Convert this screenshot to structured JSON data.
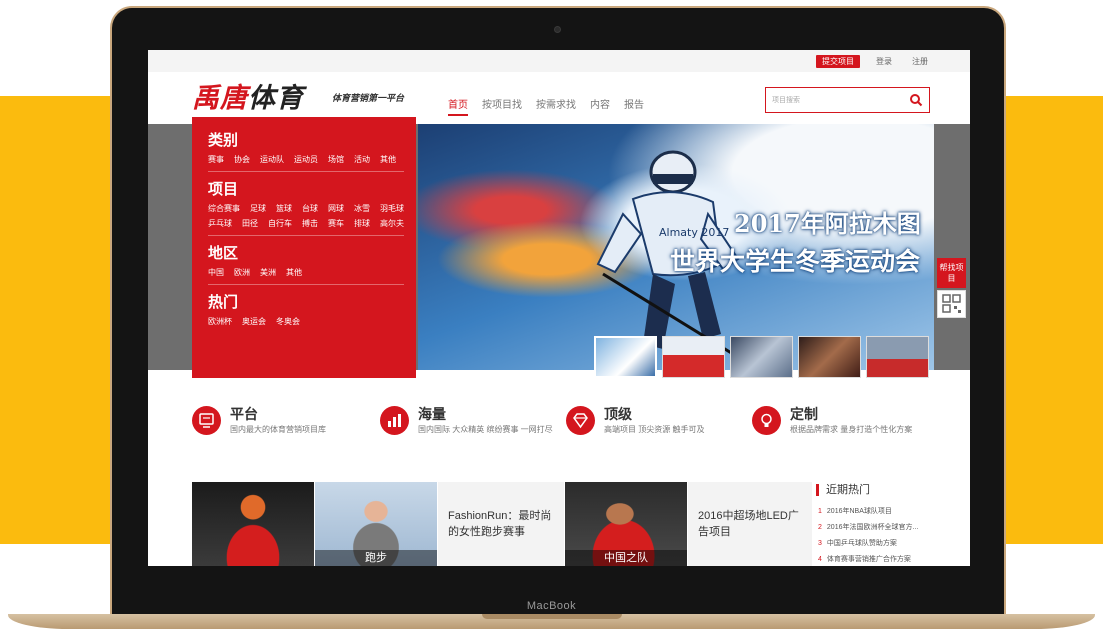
{
  "device": {
    "brand": "MacBook"
  },
  "topbar": {
    "submit_label": "提交项目",
    "login_label": "登录",
    "register_label": "注册"
  },
  "header": {
    "logo_red": "禹唐",
    "logo_dark": "体育",
    "slogan": "体育营销第一平台",
    "nav": [
      "首页",
      "按项目找",
      "按需求找",
      "内容",
      "报告"
    ],
    "search_placeholder": "项目搜索"
  },
  "categories": [
    {
      "title": "类别",
      "items": [
        "赛事",
        "协会",
        "运动队",
        "运动员",
        "场馆",
        "活动",
        "其他"
      ]
    },
    {
      "title": "项目",
      "items": [
        "综合赛事",
        "足球",
        "篮球",
        "台球",
        "网球",
        "冰雪",
        "羽毛球",
        "乒乓球",
        "田径",
        "自行车",
        "搏击",
        "赛车",
        "排球",
        "高尔夫"
      ]
    },
    {
      "title": "地区",
      "items": [
        "中国",
        "欧洲",
        "美洲",
        "其他"
      ]
    },
    {
      "title": "热门",
      "items": [
        "欧洲杯",
        "奥运会",
        "冬奥会"
      ]
    }
  ],
  "hero": {
    "title_line1": "2017年阿拉木图",
    "title_line2": "世界大学生冬季运动会",
    "jersey_text": "Almaty 2017",
    "thumb_count": 5,
    "selected_thumb": 1
  },
  "float": {
    "help_label": "帮找项目"
  },
  "features": [
    {
      "title": "平台",
      "desc": "国内最大的体育营销项目库",
      "icon": "monitor-icon"
    },
    {
      "title": "海量",
      "desc": "国内国际 大众精英 缤纷赛事 一网打尽",
      "icon": "bar-chart-icon"
    },
    {
      "title": "顶级",
      "desc": "高端项目 顶尖资源 触手可及",
      "icon": "diamond-icon"
    },
    {
      "title": "定制",
      "desc": "根据品牌需求 量身打造个性化方案",
      "icon": "lightbulb-icon"
    }
  ],
  "cards": {
    "card2_caption": "跑步",
    "card3_title": "FashionRun：最时尚的女性跑步赛事",
    "card4_caption": "中国之队",
    "card5_title": "2016中超场地LED广告项目"
  },
  "recent": {
    "title": "近期热门",
    "items": [
      {
        "num": "1",
        "text": "2016年NBA球队项目"
      },
      {
        "num": "2",
        "text": "2016年法国欧洲杯全球官方..."
      },
      {
        "num": "3",
        "text": "中国乒乓球队赞助方案"
      },
      {
        "num": "4",
        "text": "体育赛事营销推广合作方案"
      }
    ]
  },
  "colors": {
    "brand_red": "#d4161e",
    "backdrop_yellow": "#fbbb0e"
  }
}
